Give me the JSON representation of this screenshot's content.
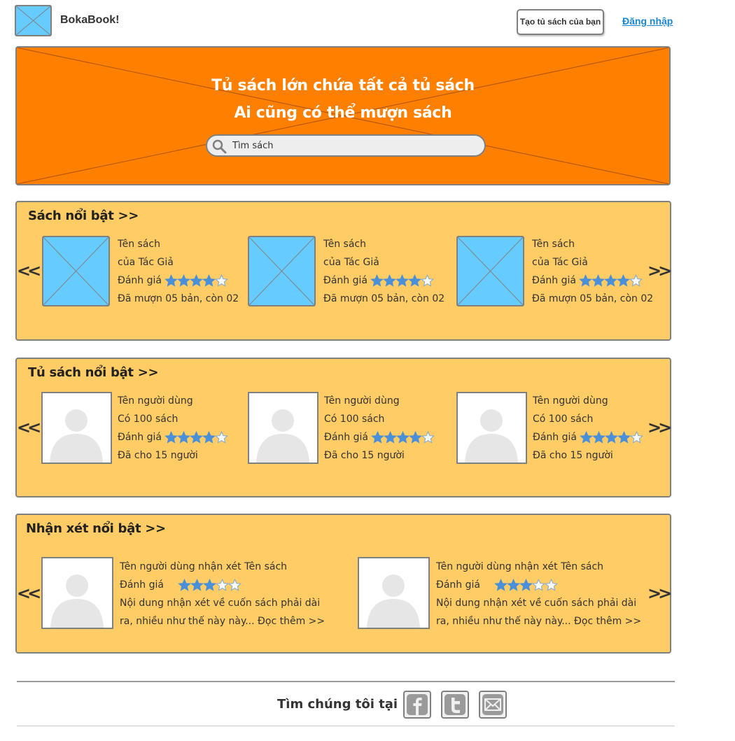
{
  "header": {
    "brand": "BokaBook!",
    "create_button": "Tạo tủ sách của bạn",
    "login_link": "Đăng nhập"
  },
  "hero": {
    "line1": "Tủ sách lớn chứa tất cả tủ sách",
    "line2": "Ai cũng có thể mượn sách",
    "search_placeholder": "Tìm sách"
  },
  "featured_books": {
    "title": "Sách nổi bật >>",
    "prev": "<<",
    "next": ">>",
    "items": [
      {
        "name": "Tên sách",
        "author": "của Tác Giả",
        "rating_label": "Đánh giá",
        "rating": 4,
        "max_rating": 5,
        "status": "Đã mượn 05 bản, còn 02"
      },
      {
        "name": "Tên sách",
        "author": "của Tác Giả",
        "rating_label": "Đánh giá",
        "rating": 4,
        "max_rating": 5,
        "status": "Đã mượn 05 bản, còn 02"
      },
      {
        "name": "Tên sách",
        "author": "của Tác Giả",
        "rating_label": "Đánh giá",
        "rating": 4,
        "max_rating": 5,
        "status": "Đã mượn 05 bản, còn 02"
      }
    ]
  },
  "featured_shelves": {
    "title": "Tủ sách nổi bật >>",
    "prev": "<<",
    "next": ">>",
    "items": [
      {
        "user": "Tên người dùng",
        "books": "Có 100 sách",
        "rating_label": "Đánh giá",
        "rating": 4,
        "max_rating": 5,
        "lent": "Đã cho 15 người"
      },
      {
        "user": "Tên người dùng",
        "books": "Có 100 sách",
        "rating_label": "Đánh giá",
        "rating": 4,
        "max_rating": 5,
        "lent": "Đã cho 15 người"
      },
      {
        "user": "Tên người dùng",
        "books": "Có 100 sách",
        "rating_label": "Đánh giá",
        "rating": 4,
        "max_rating": 5,
        "lent": "Đã cho 15 người"
      }
    ]
  },
  "featured_reviews": {
    "title": "Nhận xét nổi bật >>",
    "prev": "<<",
    "next": ">>",
    "items": [
      {
        "heading": "Tên người dùng nhận xét Tên sách",
        "rating_label": "Đánh giá",
        "rating": 3,
        "max_rating": 5,
        "body_line1": "Nội dung nhận xét về cuốn sách phải dài",
        "body_line2": "ra, nhiều như thế này này...",
        "read_more": "Đọc thêm >>"
      },
      {
        "heading": "Tên người dùng nhận xét Tên sách",
        "rating_label": "Đánh giá",
        "rating": 3,
        "max_rating": 5,
        "body_line1": "Nội dung nhận xét về cuốn sách phải dài",
        "body_line2": "ra, nhiều như thế này này...",
        "read_more": "Đọc thêm >>"
      }
    ]
  },
  "footer": {
    "find_us": "Tìm chúng tôi tại",
    "social_icons": [
      "facebook-icon",
      "twitter-icon",
      "email-icon"
    ]
  },
  "colors": {
    "hero": "#ff7f00",
    "section": "#ffcc66",
    "placeholder": "#66ccff",
    "star_filled": "#4a90d9",
    "link": "#1b87d1"
  }
}
